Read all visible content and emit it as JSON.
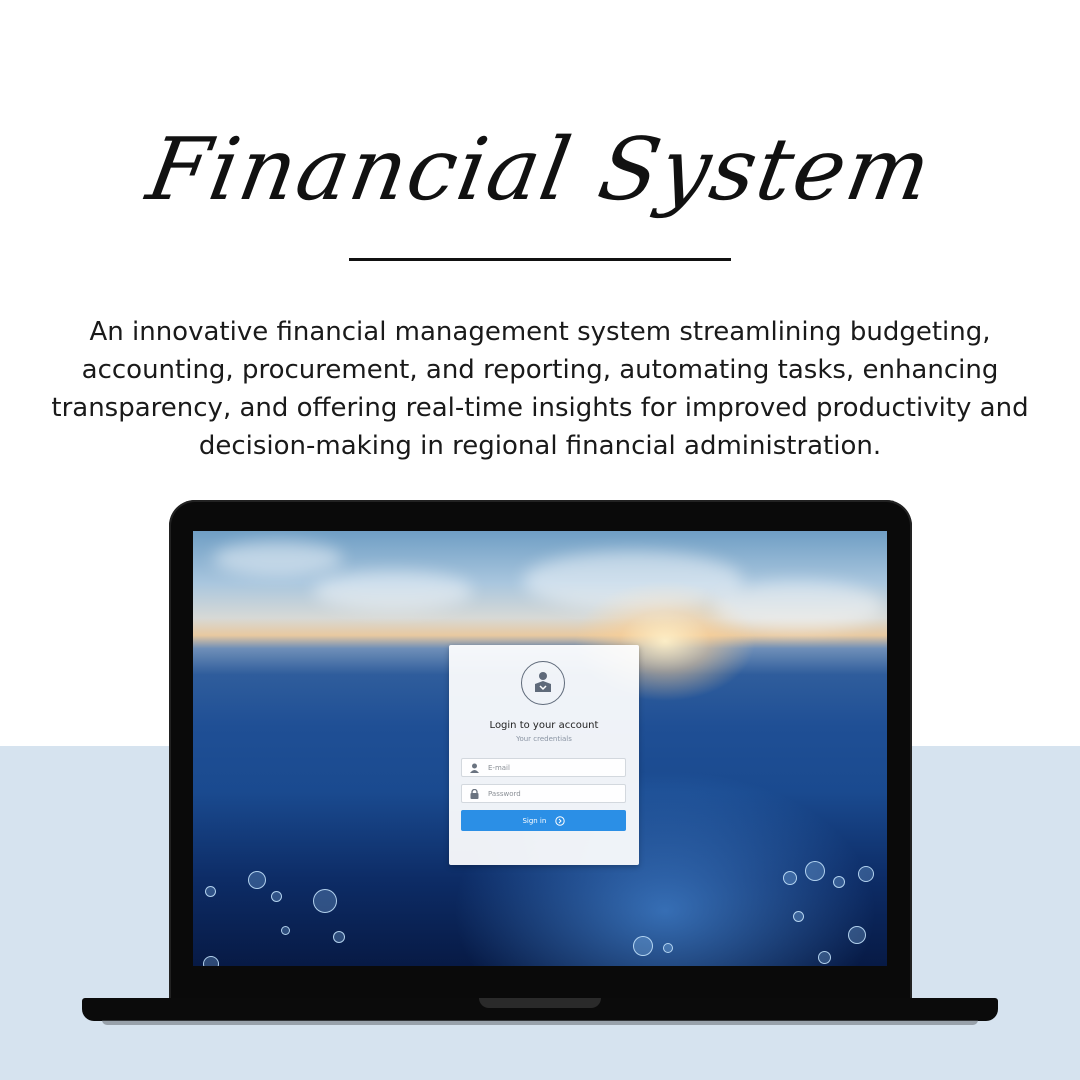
{
  "page": {
    "title": "Financial System",
    "description": "An innovative financial management system streamlining budgeting, accounting, procurement, and reporting, automating tasks, enhancing transparency, and offering real-time insights for improved productivity and decision-making in regional financial administration.",
    "colors": {
      "background": "#ffffff",
      "band": "#d6e3ef",
      "accent": "#2b8fe6"
    }
  },
  "login": {
    "logo_icon": "user-box-icon",
    "title": "Login to your account",
    "subtitle": "Your credentials",
    "email": {
      "placeholder": "E-mail",
      "value": "",
      "icon": "user-icon"
    },
    "password": {
      "placeholder": "Password",
      "value": "",
      "icon": "lock-icon"
    },
    "signin_label": "Sign in",
    "signin_icon": "circle-arrow-right-icon"
  }
}
